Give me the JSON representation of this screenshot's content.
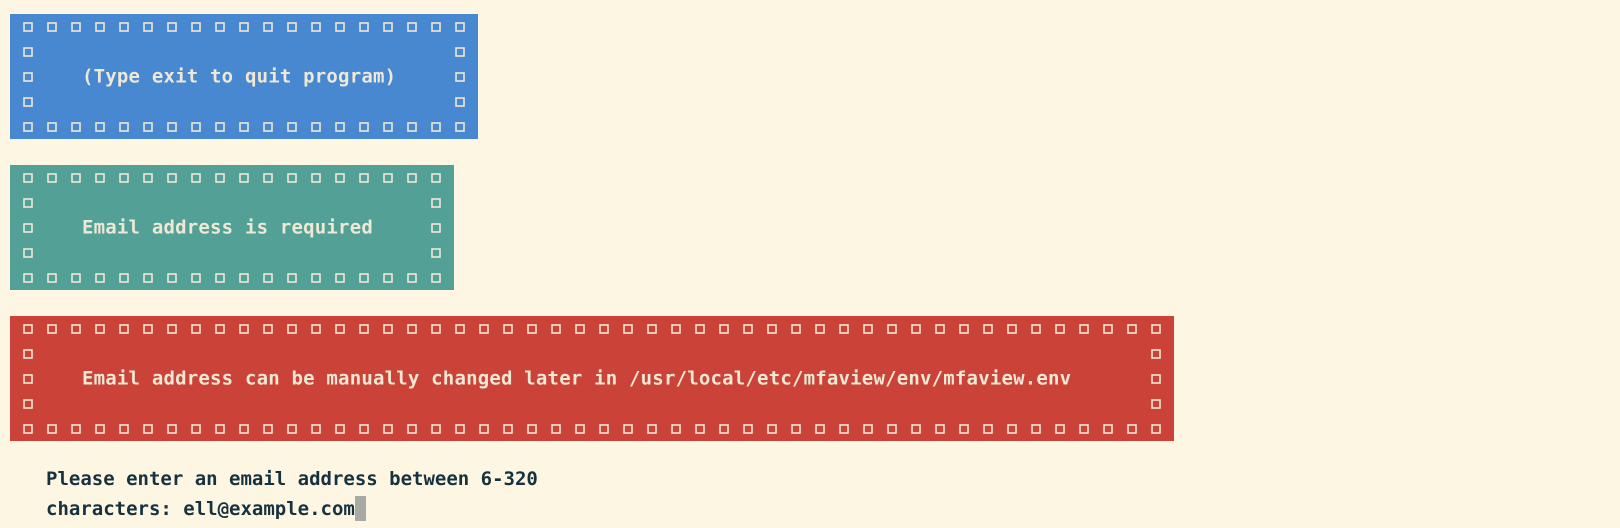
{
  "banners": {
    "exit_hint": "(Type exit to quit program)",
    "required_notice": "Email address is required",
    "change_notice": "Email address can be manually changed later in /usr/local/etc/mfaview/env/mfaview.env"
  },
  "prompt": {
    "line1": "Please enter an email address between 6-320",
    "line2_label": "characters: ",
    "input_value": "ell@example.com"
  },
  "colors": {
    "background": "#fdf6e3",
    "blue_banner": "#4788d0",
    "teal_banner": "#53a096",
    "red_banner": "#cb4338",
    "banner_text": "#eee8d5",
    "prompt_text": "#17323e",
    "cursor": "#a8aaa6"
  }
}
